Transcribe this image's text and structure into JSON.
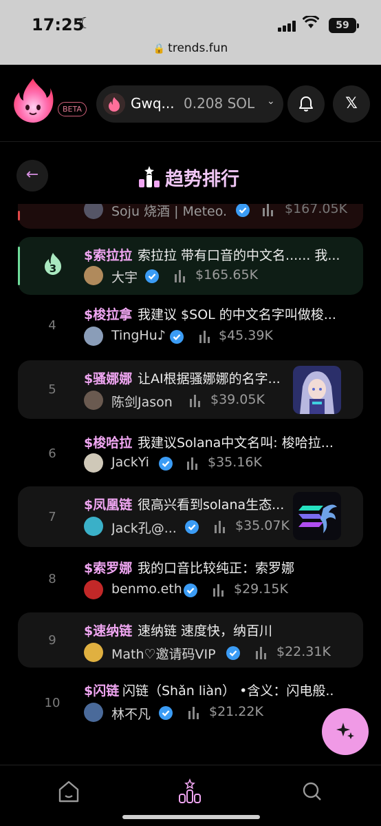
{
  "status": {
    "time": "17:25",
    "battery": "59",
    "url": "trends.fun"
  },
  "header": {
    "beta_label": "BETA",
    "wallet_name": "Gwq...",
    "wallet_balance": "0.208 SOL"
  },
  "page": {
    "title": "趋势排行"
  },
  "partial_row": {
    "user": "Soju 烧酒 | Meteo...",
    "mcap": "$167.05K"
  },
  "items": [
    {
      "rank": "3",
      "ticker": "$索拉拉",
      "desc": "索拉拉 带有口音的中文名...... 我...",
      "user": "大宇",
      "mcap": "$165.65K",
      "thumb": false
    },
    {
      "rank": "4",
      "ticker": "$梭拉拿",
      "desc": "我建议 $SOL 的中文名字叫做梭...",
      "user": "TingHu♪",
      "mcap": "$45.39K",
      "thumb": false
    },
    {
      "rank": "5",
      "ticker": "$骚娜娜",
      "desc": "让AI根据骚娜娜的名字...",
      "user": "陈剑Jason",
      "mcap": "$39.05K",
      "thumb": true
    },
    {
      "rank": "6",
      "ticker": "$梭哈拉",
      "desc": "我建议Solana中文名叫: 梭哈拉...",
      "user": "JackYi",
      "mcap": "$35.16K",
      "thumb": false
    },
    {
      "rank": "7",
      "ticker": "$凤凰链",
      "desc": "很高兴看到solana生态...",
      "user": "Jack孔@...",
      "mcap": "$35.07K",
      "thumb": true
    },
    {
      "rank": "8",
      "ticker": "$索罗娜",
      "desc": "我的口音比较纯正：索罗娜",
      "user": "benmo.eth",
      "mcap": "$29.15K",
      "thumb": false
    },
    {
      "rank": "9",
      "ticker": "$速纳链",
      "desc": "速纳链 速度快，纳百川",
      "user": "Math♡邀请码VIP",
      "mcap": "$22.31K",
      "thumb": false
    },
    {
      "rank": "10",
      "ticker": "$闪链",
      "desc": "闪链（Shǎn liàn） •含义：闪电般...",
      "user": "林不凡",
      "mcap": "$21.22K",
      "thumb": false
    }
  ],
  "colors": {
    "accent": "#f0a6f2",
    "verified": "#3b9cf5",
    "fab": "#f09ae6"
  }
}
